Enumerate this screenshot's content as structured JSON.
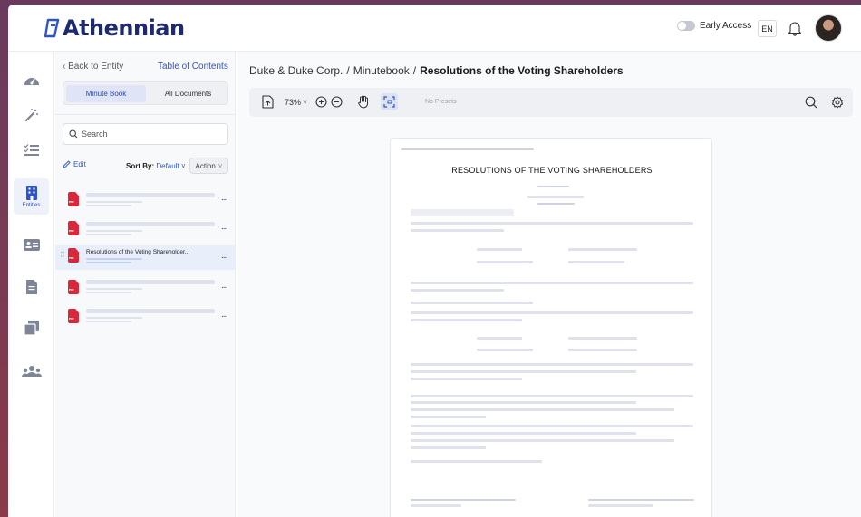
{
  "header": {
    "logo_text": "Athennian",
    "early_access_label": "Early Access",
    "language": "EN"
  },
  "nav": {
    "active_label": "Entities",
    "items": [
      "dashboard-icon",
      "magic-wand-icon",
      "checklist-icon",
      "building-icon",
      "id-card-icon",
      "document-icon",
      "stack-icon",
      "users-icon"
    ]
  },
  "sidebar": {
    "back_label": "Back to Entity",
    "toc_label": "Table of Contents",
    "tabs": [
      "Minute Book",
      "All Documents"
    ],
    "search_placeholder": "Search",
    "edit_label": "Edit",
    "sort_label": "Sort By:",
    "sort_value": "Default",
    "action_label": "Action",
    "files": [
      {
        "name": "",
        "selected": false
      },
      {
        "name": "",
        "selected": false
      },
      {
        "name": "Resolutions of the Voting Shareholder...",
        "selected": true
      },
      {
        "name": "",
        "selected": false
      },
      {
        "name": "",
        "selected": false
      }
    ],
    "file_icon_label": "PDF",
    "more_label": "..."
  },
  "main": {
    "breadcrumbs": [
      "Duke & Duke Corp.",
      "Minutebook",
      "Resolutions of the Voting Shareholders"
    ],
    "zoom_value": "73%",
    "presets_label": "No Presets",
    "document_title": "RESOLUTIONS OF THE VOTING SHAREHOLDERS"
  },
  "colors": {
    "brand": "#1e2a6b",
    "accent": "#2c55c8",
    "pdf_red": "#d9283a"
  }
}
